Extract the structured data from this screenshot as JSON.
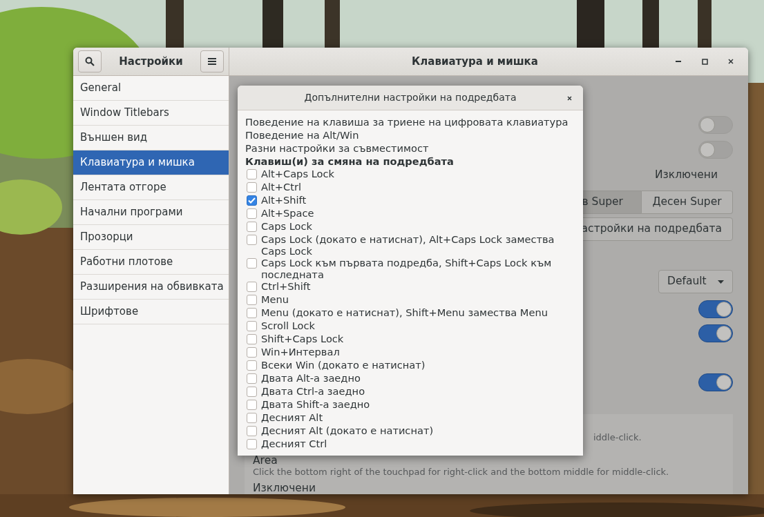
{
  "window": {
    "app_title": "Настройки",
    "title": "Клавиатура и мишка"
  },
  "sidebar": {
    "items": [
      {
        "label": "General",
        "selected": false
      },
      {
        "label": "Window Titlebars",
        "selected": false
      },
      {
        "label": "Външен вид",
        "selected": false
      },
      {
        "label": "Клавиатура и мишка",
        "selected": true
      },
      {
        "label": "Лентата отгоре",
        "selected": false
      },
      {
        "label": "Начални програми",
        "selected": false
      },
      {
        "label": "Прозорци",
        "selected": false
      },
      {
        "label": "Работни плотове",
        "selected": false
      },
      {
        "label": "Разширения на обвивката",
        "selected": false
      },
      {
        "label": "Шрифтове",
        "selected": false
      }
    ]
  },
  "content": {
    "rows": [
      {
        "kind": "switch",
        "on": false
      },
      {
        "kind": "switch",
        "on": false
      },
      {
        "kind": "label",
        "text": "Изключени"
      },
      {
        "kind": "segmented",
        "buttons": [
          {
            "label": "в Super",
            "selected": true
          },
          {
            "label": "Десен Super",
            "selected": false
          }
        ]
      },
      {
        "kind": "button",
        "label": "астройки на подредбата"
      },
      {
        "kind": "dropdown",
        "value": "Default"
      },
      {
        "kind": "switch",
        "on": true
      },
      {
        "kind": "switch",
        "on": true
      },
      {
        "kind": "switch",
        "on": true
      }
    ],
    "panel": {
      "texts": [
        {
          "kind": "desc",
          "text": "iddle-click."
        },
        {
          "kind": "title",
          "text": "Area"
        },
        {
          "kind": "desc",
          "text": "Click the bottom right of the touchpad for right-click and the bottom middle for middle-click."
        },
        {
          "kind": "title",
          "text": "Изключени"
        }
      ]
    }
  },
  "dialog": {
    "title": "Допълнителни настройки на подредбата",
    "sections": [
      "Поведение на клавиша за триене на цифровата клавиатура",
      "Поведение на Alt/Win",
      "Разни настройки за съвместимост"
    ],
    "heading": "Клавиш(и) за смяна на подредбата",
    "options": [
      {
        "label": "Alt+Caps Lock",
        "checked": false
      },
      {
        "label": "Alt+Ctrl",
        "checked": false
      },
      {
        "label": "Alt+Shift",
        "checked": true
      },
      {
        "label": "Alt+Space",
        "checked": false
      },
      {
        "label": "Caps Lock",
        "checked": false
      },
      {
        "label": "Caps Lock (докато е натиснат), Alt+Caps Lock замества Caps Lock",
        "checked": false
      },
      {
        "label": "Caps Lock към първата подредба, Shift+Caps Lock към последната",
        "checked": false
      },
      {
        "label": "Ctrl+Shift",
        "checked": false
      },
      {
        "label": "Menu",
        "checked": false
      },
      {
        "label": "Menu (докато е натиснат), Shift+Menu замества Menu",
        "checked": false
      },
      {
        "label": "Scroll Lock",
        "checked": false
      },
      {
        "label": "Shift+Caps Lock",
        "checked": false
      },
      {
        "label": "Win+Интервал",
        "checked": false
      },
      {
        "label": "Всеки Win (докато е натиснат)",
        "checked": false
      },
      {
        "label": "Двата Alt-а заедно",
        "checked": false
      },
      {
        "label": "Двата Ctrl-а заедно",
        "checked": false
      },
      {
        "label": "Двата Shift-а заедно",
        "checked": false
      },
      {
        "label": "Десният Alt",
        "checked": false
      },
      {
        "label": "Десният Alt (докато е натиснат)",
        "checked": false
      },
      {
        "label": "Десният Ctrl",
        "checked": false
      }
    ]
  }
}
